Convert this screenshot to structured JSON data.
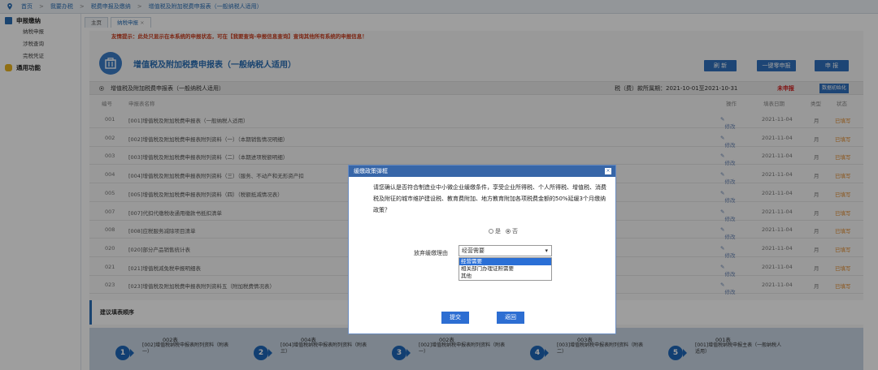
{
  "breadcrumb": {
    "items": [
      "首页",
      "我要办税",
      "税费申报及缴纳",
      "增值税及附加税费申报表（一般纳税人适用）"
    ],
    "sep": ">"
  },
  "sidebar": {
    "group1": "申报缴纳",
    "subitems": [
      "纳税申报",
      "涉税查询",
      "完税凭证"
    ],
    "group2": "通用功能"
  },
  "tabs": [
    "主页",
    "纳税申报"
  ],
  "tab_close": "×",
  "tip": "友情提示：此处只显示在本系统的申报状态，可在【我要查询-申报信息查询】查询其他所有系统的申报信息！",
  "header": {
    "title": "增值税及附加税费申报表（一般纳税人适用）"
  },
  "buttons": {
    "refresh": "刷 新",
    "zero": "一键零申报",
    "declare": "申 报"
  },
  "section": {
    "label": "增值税及附加税费申报表（一般纳税人适用）",
    "period": "税（费）款所属期：2021-10-01至2021-10-31",
    "status": "未申报",
    "init": "数据初始化"
  },
  "table": {
    "headers": {
      "no": "编号",
      "name": "申报表名称",
      "op": "操作",
      "date": "填表日期",
      "type": "类型",
      "status": "状态"
    },
    "rows": [
      {
        "no": "001",
        "name": "[001]增值税及附加税费申报表（一般纳税人适用）",
        "op": "修改",
        "date": "2021-11-04",
        "type": "月",
        "status": "已填写"
      },
      {
        "no": "002",
        "name": "[002]增值税及附加税费申报表附列资料（一）（本期销售情况明细）",
        "op": "修改",
        "date": "2021-11-04",
        "type": "月",
        "status": "已填写"
      },
      {
        "no": "003",
        "name": "[003]增值税及附加税费申报表附列资料（二）（本期进项税额明细）",
        "op": "修改",
        "date": "2021-11-04",
        "type": "月",
        "status": "已填写"
      },
      {
        "no": "004",
        "name": "[004]增值税及附加税费申报表附列资料（三）（服务、不动产和无形资产扣",
        "op": "修改",
        "date": "2021-11-04",
        "type": "月",
        "status": "已填写"
      },
      {
        "no": "005",
        "name": "[005]增值税及附加税费申报表附列资料（四）（税额抵减情况表）",
        "op": "修改",
        "date": "2021-11-04",
        "type": "月",
        "status": "已填写"
      },
      {
        "no": "007",
        "name": "[007]代扣代缴税收通用缴款书抵扣清单",
        "op": "修改",
        "date": "2021-11-04",
        "type": "月",
        "status": "已填写"
      },
      {
        "no": "008",
        "name": "[008]应税服务减除项目清单",
        "op": "修改",
        "date": "2021-11-04",
        "type": "月",
        "status": "已填写"
      },
      {
        "no": "020",
        "name": "[020]部分产品销售统计表",
        "op": "修改",
        "date": "2021-11-04",
        "type": "月",
        "status": "已填写"
      },
      {
        "no": "021",
        "name": "[021]增值税减免税申报明细表",
        "op": "修改",
        "date": "2021-11-04",
        "type": "月",
        "status": "已填写"
      },
      {
        "no": "023",
        "name": "[023]增值税及附加税费申报表附列资料五（附加税费情况表）",
        "op": "修改",
        "date": "2021-11-04",
        "type": "月",
        "status": "已填写"
      }
    ]
  },
  "suggest": "建议填表顺序",
  "steps": [
    {
      "n": "1",
      "code": "002表",
      "desc": "[002]增值税纳税申报表附列资料（附表一）"
    },
    {
      "n": "2",
      "code": "004表",
      "desc": "[004]增值税纳税申报表附列资料（附表三）"
    },
    {
      "n": "3",
      "code": "002表",
      "desc": "[002]增值税纳税申报表附列资料（附表一）"
    },
    {
      "n": "4",
      "code": "003表",
      "desc": "[003]增值税纳税申报表附列资料（附表二）"
    },
    {
      "n": "5",
      "code": "001表",
      "desc": "[001]增值税纳税申报主表（一般纳税人适用）"
    }
  ],
  "modal": {
    "title": "缓缴政策弹框",
    "close": "×",
    "question": "请您确认是否符合制造业中小微企业缓缴条件，享受企业所得税、个人所得税、增值税、消费税及附征的城市维护建设税、教育费附加、地方教育附加各项税费金额的50%延缓3个月缴纳政策？",
    "yes": "是",
    "no": "否",
    "reason_label": "放弃缓缴理由",
    "reason_value": "经营需要",
    "options": [
      "经营需要",
      "相关部门办理证照需要",
      "其他"
    ],
    "submit": "提交",
    "back": "返回"
  },
  "colors": {
    "accent": "#2f70bd",
    "modal_head": "#3766a8",
    "warning": "#c83c1e",
    "done": "#e08a2b"
  }
}
